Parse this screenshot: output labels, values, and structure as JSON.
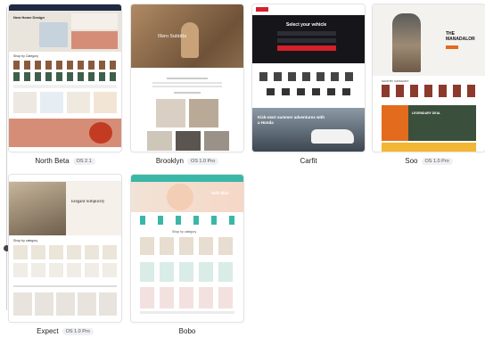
{
  "themes": [
    {
      "name": "North Beta",
      "version": "OS 2.1",
      "hero_text": "New Home Design",
      "section_text": "Shop by Category"
    },
    {
      "name": "Brooklyn",
      "version": "OS 1.0 Pro",
      "hero_text": "Hero Subtitle"
    },
    {
      "name": "Carfit",
      "version": "",
      "hero_text": "Select your vehicle",
      "banner_text": "Kick-start summer adventures with a Honda"
    },
    {
      "name": "Soo",
      "version": "OS 1.0 Pro",
      "hero_text": "THE MANADALOR",
      "section_text": "SHOP BY CATEGORY",
      "promo_text": "LEGENDARY DEAL"
    },
    {
      "name": "Expect",
      "version": "OS 1.0 Pro",
      "hero_text": "Elegant Simplicity",
      "section_text": "Shop by category"
    },
    {
      "name": "Bobo",
      "version": "",
      "hero_text": "Soft Skin",
      "section_text": "Shop by category"
    }
  ],
  "colors": {
    "north_nav": "#1f2a44",
    "north_hero": "#e9e4dc",
    "north_banner": "#d58d78",
    "carfit_nav": "#15151a",
    "carfit_accent": "#d51f2a",
    "soo_accent": "#e26b1d",
    "soo_yellow": "#f2b632",
    "bobo_teal": "#3bb7a7",
    "expect_hero": "#c7b69b"
  }
}
